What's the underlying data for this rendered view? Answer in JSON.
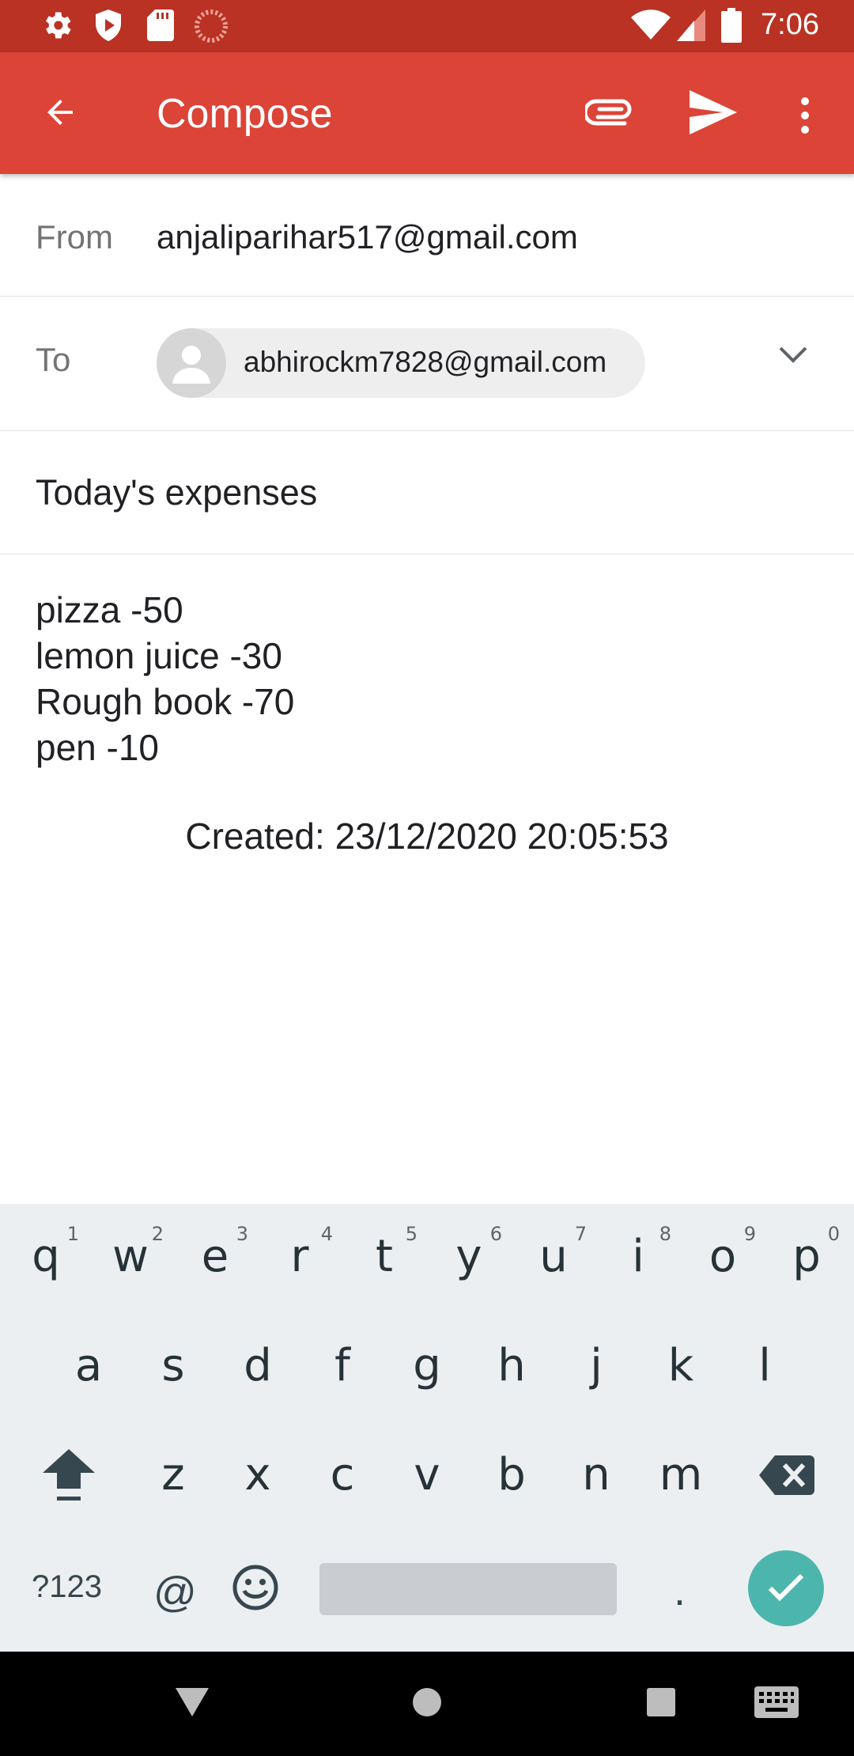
{
  "status_bar": {
    "time": "7:06",
    "left_icons": [
      "settings-icon",
      "shield-play-icon",
      "sd-card-icon",
      "sync-icon"
    ],
    "right_icons": [
      "wifi-icon",
      "signal-icon",
      "battery-icon"
    ]
  },
  "app_bar": {
    "title": "Compose",
    "back_icon": "arrow-left-icon",
    "actions": [
      "attach-icon",
      "send-icon",
      "more-vert-icon"
    ],
    "color": "#db4437"
  },
  "from": {
    "label": "From",
    "value": "anjaliparihar517@gmail.com"
  },
  "to": {
    "label": "To",
    "recipient": "abhirockm7828@gmail.com",
    "expand_icon": "chevron-down-icon"
  },
  "subject": {
    "value": "Today's expenses"
  },
  "body": {
    "lines": [
      "pizza -50",
      "lemon juice -30",
      "Rough book -70",
      "pen -10"
    ],
    "created": "Created:  23/12/2020 20:05:53"
  },
  "keyboard": {
    "row1": [
      {
        "k": "q",
        "h": "1"
      },
      {
        "k": "w",
        "h": "2"
      },
      {
        "k": "e",
        "h": "3"
      },
      {
        "k": "r",
        "h": "4"
      },
      {
        "k": "t",
        "h": "5"
      },
      {
        "k": "y",
        "h": "6"
      },
      {
        "k": "u",
        "h": "7"
      },
      {
        "k": "i",
        "h": "8"
      },
      {
        "k": "o",
        "h": "9"
      },
      {
        "k": "p",
        "h": "0"
      }
    ],
    "row2": [
      "a",
      "s",
      "d",
      "f",
      "g",
      "h",
      "j",
      "k",
      "l"
    ],
    "row3": [
      "z",
      "x",
      "c",
      "v",
      "b",
      "n",
      "m"
    ],
    "symbols_label": "?123",
    "at_label": "@",
    "period_label": ".",
    "accent_color": "#4db6ac"
  },
  "nav_bar": {
    "icons": [
      "back-triangle-icon",
      "home-circle-icon",
      "recents-square-icon",
      "keyboard-icon"
    ]
  }
}
